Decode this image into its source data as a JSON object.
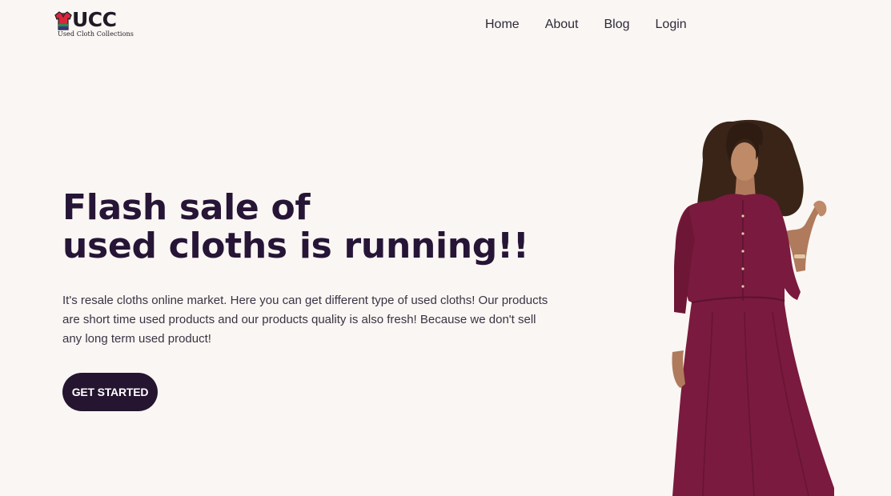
{
  "brand": {
    "name": "UCC",
    "tagline": "Used Cloth Collections"
  },
  "nav": {
    "items": [
      {
        "label": "Home"
      },
      {
        "label": "About"
      },
      {
        "label": "Blog"
      },
      {
        "label": "Login"
      }
    ]
  },
  "hero": {
    "title_line1": "Flash sale of",
    "title_line2": "used cloths is running!!",
    "description": "It's resale cloths online market. Here you can get different type of used cloths! Our products are short time used products and our products quality is also fresh! Because we don't sell any long term used product!",
    "cta_label": "GET STARTED",
    "image_icon": "model-in-burgundy-dress"
  },
  "colors": {
    "background": "#faf6f3",
    "primary": "#251530",
    "dress": "#7a1a3e",
    "logo_red": "#d6283a",
    "logo_green": "#2f8a4a"
  }
}
